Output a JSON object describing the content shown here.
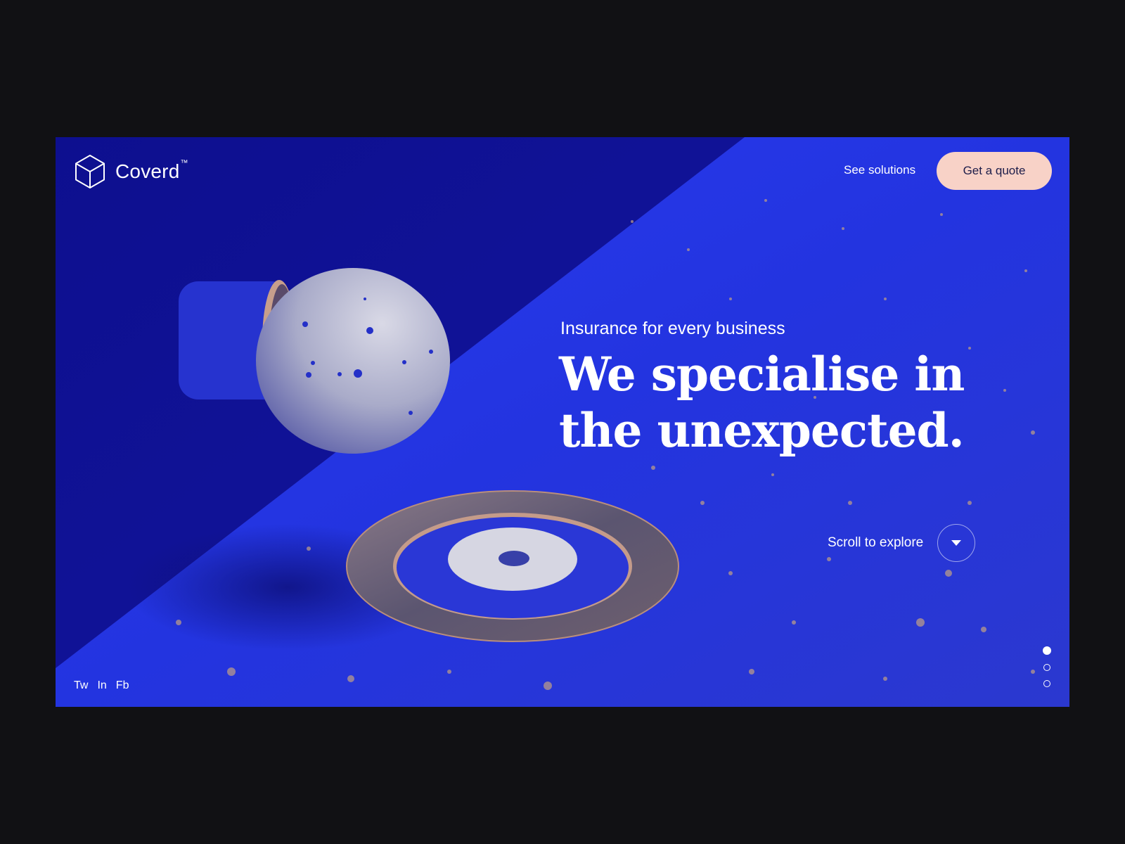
{
  "brand": {
    "name": "Coverd",
    "trademark": "™",
    "logo_icon": "cube-outline-icon"
  },
  "nav": {
    "solutions_label": "See solutions",
    "quote_label": "Get a quote"
  },
  "hero": {
    "kicker": "Insurance for every business",
    "headline_line1": "We specialise in",
    "headline_line2": "the unexpected."
  },
  "scroll": {
    "label": "Scroll to explore",
    "icon": "chevron-down-icon"
  },
  "social": [
    "Tw",
    "In",
    "Fb"
  ],
  "pager": {
    "count": 3,
    "active_index": 0
  },
  "colors": {
    "background": "#111114",
    "hero_blue": "#1f2ed6",
    "hero_deep_blue": "#0e0f8a",
    "cta_fill": "#f8d2c7",
    "cta_text": "#1d1d4a",
    "text": "#ffffff"
  }
}
